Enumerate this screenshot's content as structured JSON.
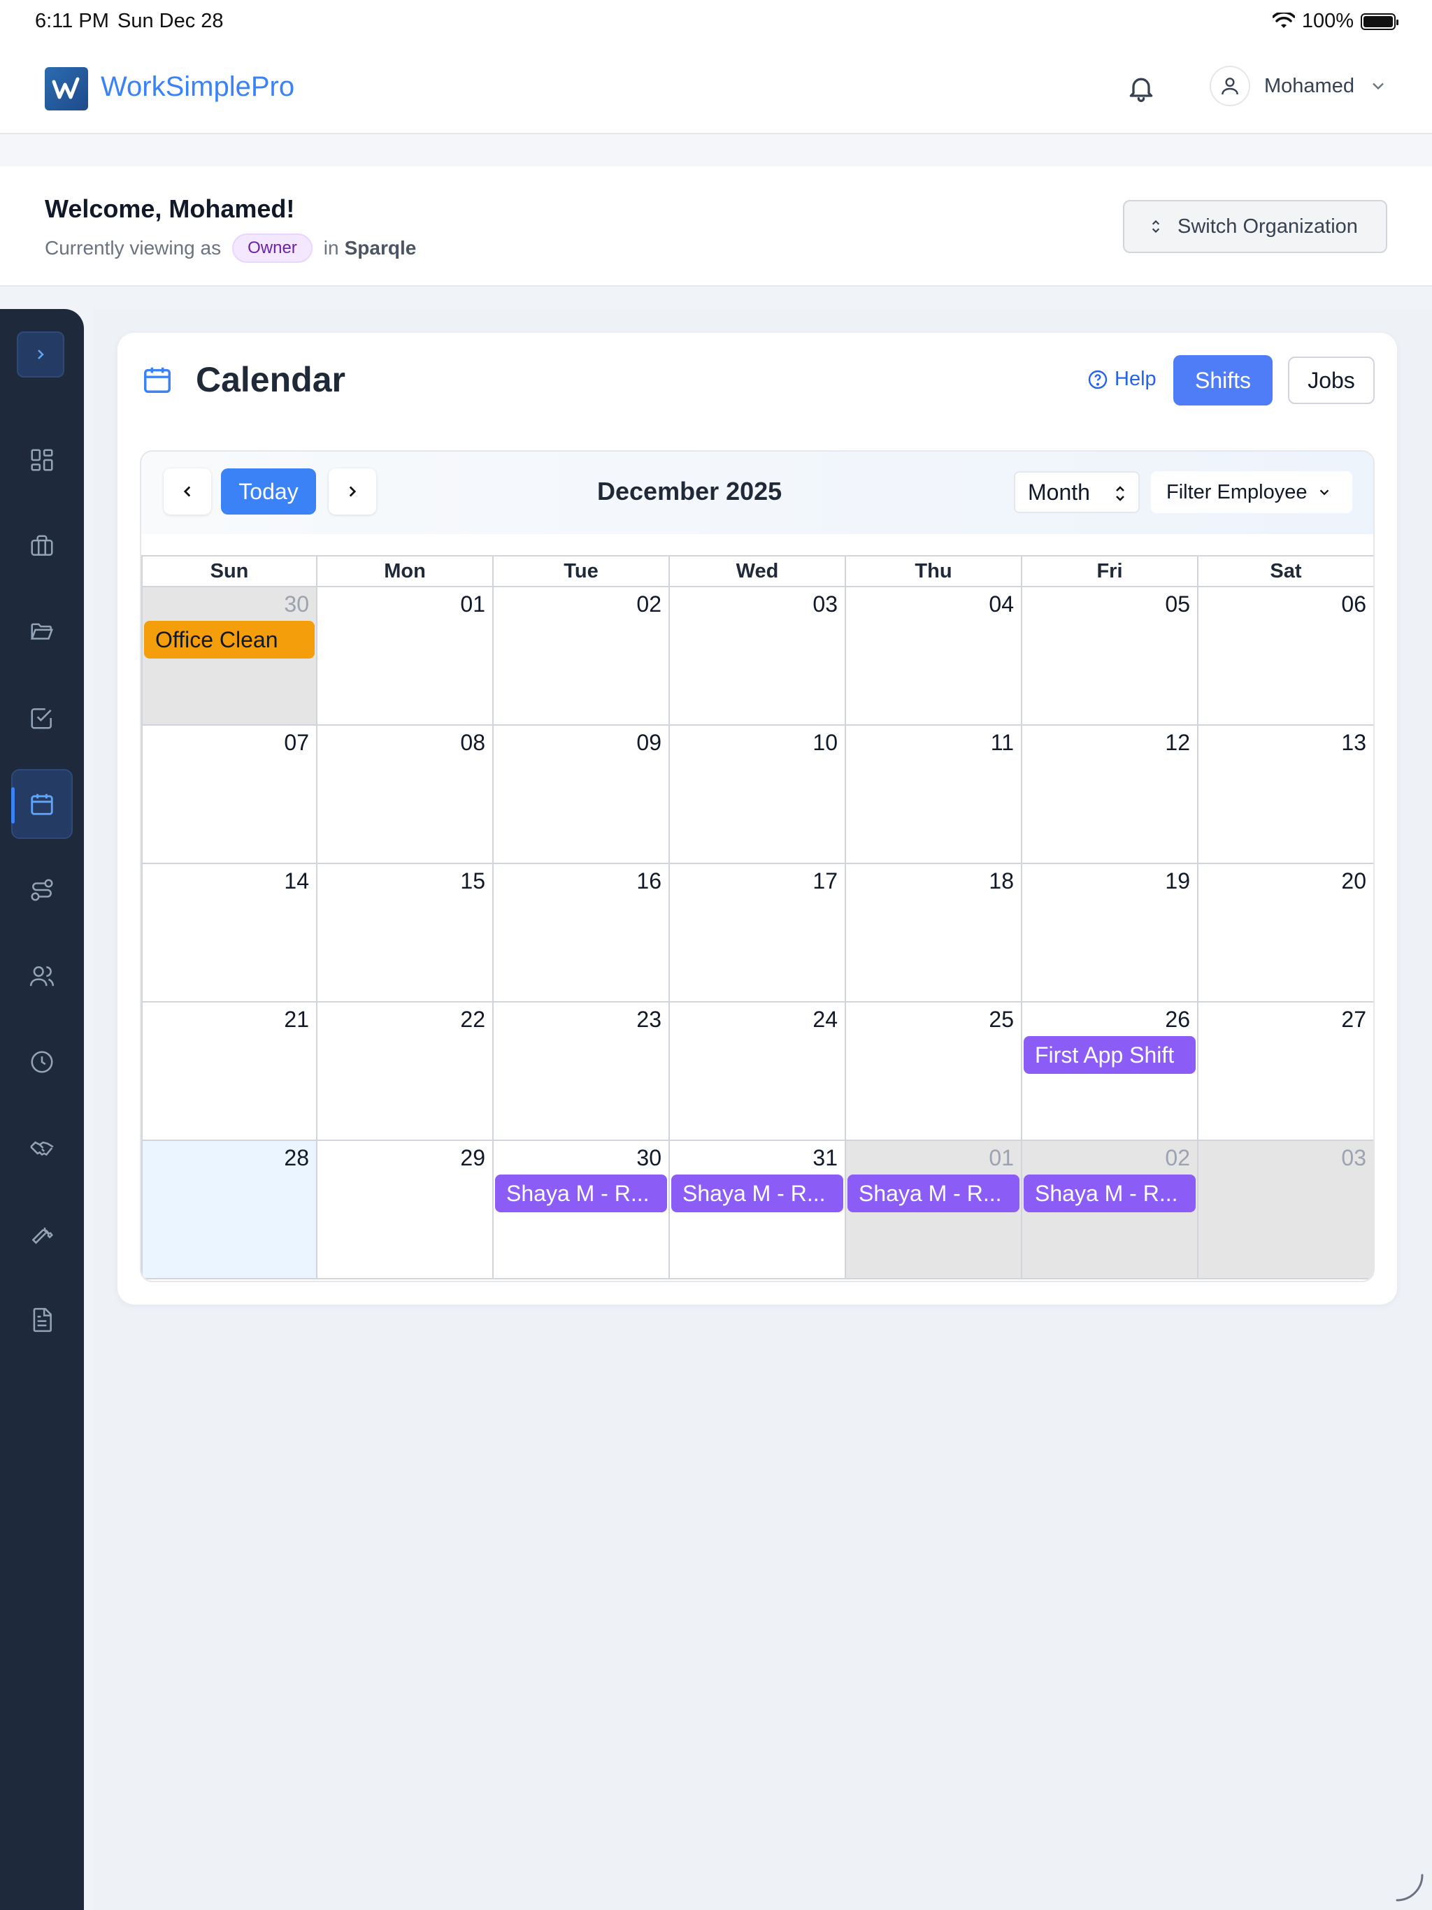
{
  "status_bar": {
    "time": "6:11 PM",
    "date": "Sun Dec 28",
    "battery": "100%"
  },
  "header": {
    "brand": "WorkSimplePro",
    "user_name": "Mohamed"
  },
  "welcome": {
    "title": "Welcome, Mohamed!",
    "viewing_prefix": "Currently viewing as",
    "role": "Owner",
    "in_label": "in",
    "organization": "Sparqle",
    "switch_button": "Switch Organization"
  },
  "sidebar": {
    "items": [
      {
        "icon": "dashboard-icon"
      },
      {
        "icon": "briefcase-icon"
      },
      {
        "icon": "folder-icon"
      },
      {
        "icon": "checklist-icon"
      },
      {
        "icon": "calendar-icon",
        "active": true
      },
      {
        "icon": "workflow-icon"
      },
      {
        "icon": "users-icon"
      },
      {
        "icon": "clock-icon"
      },
      {
        "icon": "handshake-icon"
      },
      {
        "icon": "wrench-icon"
      },
      {
        "icon": "document-icon"
      }
    ]
  },
  "calendar": {
    "title": "Calendar",
    "help": "Help",
    "shifts_button": "Shifts",
    "jobs_button": "Jobs",
    "today_button": "Today",
    "month_label": "December 2025",
    "view_select": "Month",
    "filter_button": "Filter Employee",
    "weekdays": [
      "Sun",
      "Mon",
      "Tue",
      "Wed",
      "Thu",
      "Fri",
      "Sat"
    ],
    "weeks": [
      [
        {
          "d": "30",
          "other": true,
          "event": {
            "label": "Office Clean",
            "color": "orange"
          }
        },
        {
          "d": "01"
        },
        {
          "d": "02"
        },
        {
          "d": "03"
        },
        {
          "d": "04"
        },
        {
          "d": "05"
        },
        {
          "d": "06"
        }
      ],
      [
        {
          "d": "07"
        },
        {
          "d": "08"
        },
        {
          "d": "09"
        },
        {
          "d": "10"
        },
        {
          "d": "11"
        },
        {
          "d": "12"
        },
        {
          "d": "13"
        }
      ],
      [
        {
          "d": "14"
        },
        {
          "d": "15"
        },
        {
          "d": "16"
        },
        {
          "d": "17"
        },
        {
          "d": "18"
        },
        {
          "d": "19"
        },
        {
          "d": "20"
        }
      ],
      [
        {
          "d": "21"
        },
        {
          "d": "22"
        },
        {
          "d": "23"
        },
        {
          "d": "24"
        },
        {
          "d": "25"
        },
        {
          "d": "26",
          "event": {
            "label": "First App Shift",
            "color": "purple"
          }
        },
        {
          "d": "27"
        }
      ],
      [
        {
          "d": "28",
          "today": true
        },
        {
          "d": "29"
        },
        {
          "d": "30",
          "event": {
            "label": "Shaya M - R...",
            "color": "purple"
          }
        },
        {
          "d": "31",
          "event": {
            "label": "Shaya M - R...",
            "color": "purple"
          }
        },
        {
          "d": "01",
          "other": true,
          "event": {
            "label": "Shaya M - R...",
            "color": "purple"
          }
        },
        {
          "d": "02",
          "other": true,
          "event": {
            "label": "Shaya M - R...",
            "color": "purple"
          }
        },
        {
          "d": "03",
          "other": true
        }
      ]
    ]
  },
  "colors": {
    "accent": "#3b82f6",
    "sidebar": "#1e293b",
    "event_orange": "#f59e0b",
    "event_purple": "#8b5cf6"
  }
}
